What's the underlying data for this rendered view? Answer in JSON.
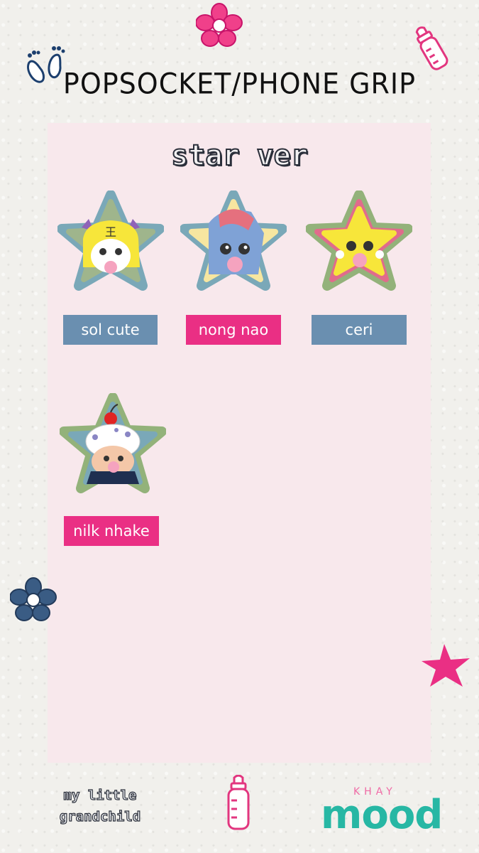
{
  "header": {
    "title": "POPSOCKET/PHONE GRIP"
  },
  "section": {
    "subtitle": "star ver"
  },
  "products": [
    {
      "label": "sol cute"
    },
    {
      "label": "nong nao"
    },
    {
      "label": "ceri"
    },
    {
      "label": "nilk nhake"
    }
  ],
  "footer": {
    "tagline_line1": "my little",
    "tagline_line2": "grandchild",
    "brand_top": "KHAY",
    "brand_main": "mood"
  },
  "colors": {
    "panel": "#f8e8ec",
    "label_blue": "#6a8fb0",
    "label_pink": "#ea2f84",
    "star_blue_border": "#7aa8b8",
    "star_green_border": "#93b27a",
    "accent_pink": "#ea2f84"
  },
  "icons": [
    "footprints-icon",
    "flower-icon",
    "baby-bottle-icon",
    "star-icon"
  ]
}
